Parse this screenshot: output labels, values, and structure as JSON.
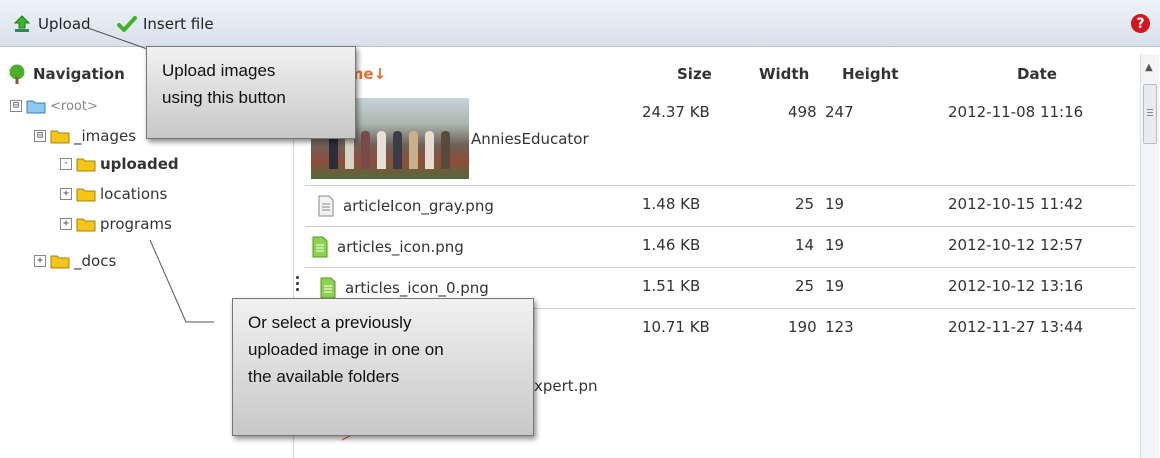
{
  "toolbar": {
    "upload_label": "Upload",
    "insert_label": "Insert file",
    "help_label": "?"
  },
  "navigation": {
    "title": "Navigation",
    "tree": [
      {
        "label": "<root>",
        "expander": "⊟"
      },
      {
        "label": "_images",
        "expander": "⊟"
      },
      {
        "label": "uploaded",
        "expander": "·"
      },
      {
        "label": "locations",
        "expander": "+"
      },
      {
        "label": "programs",
        "expander": "+"
      },
      {
        "label": "_docs",
        "expander": "+"
      }
    ]
  },
  "file_list": {
    "columns": {
      "name": "name↓",
      "size": "Size",
      "width": "Width",
      "height": "Height",
      "date": "Date"
    },
    "rows": [
      {
        "name": "AnniesEducator",
        "size": "24.37 KB",
        "width": "498",
        "height": "247",
        "date": "2012-11-08 11:16"
      },
      {
        "name": "articleIcon_gray.png",
        "size": "1.48 KB",
        "width": "25",
        "height": "19",
        "date": "2012-10-15 11:42"
      },
      {
        "name": "articles_icon.png",
        "size": "1.46 KB",
        "width": "14",
        "height": "19",
        "date": "2012-10-12 12:57"
      },
      {
        "name": "articles_icon_0.png",
        "size": "1.51 KB",
        "width": "25",
        "height": "19",
        "date": "2012-10-12 13:16"
      },
      {
        "name": "xpert.pn",
        "size": "10.71 KB",
        "width": "190",
        "height": "123",
        "date": "2012-11-27 13:44"
      }
    ]
  },
  "callouts": {
    "upload_tip": [
      "Upload images",
      "using this button"
    ],
    "select_tip": [
      "Or select a previously",
      "uploaded image in one on",
      "the available folders"
    ]
  },
  "colors": {
    "accent_sort": "#e8702a",
    "folder": "#f5c518",
    "help": "#d5141e",
    "check": "#3cb527"
  }
}
